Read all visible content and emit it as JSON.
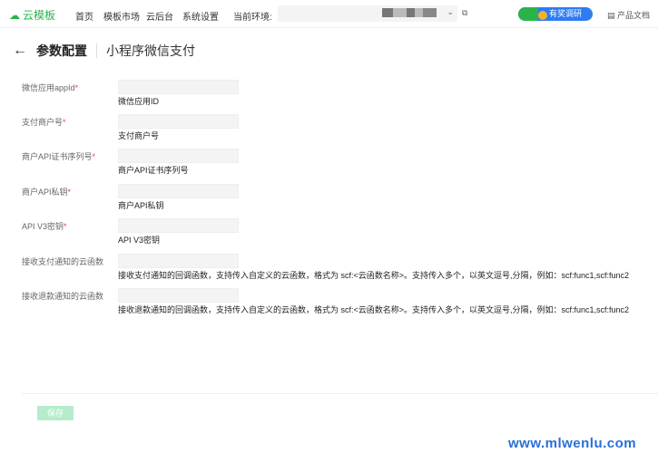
{
  "header": {
    "logo": "云模板",
    "nav": [
      "首页",
      "模板市场",
      "云后台",
      "系统设置"
    ],
    "env_label": "当前环境:",
    "survey": "有奖调研",
    "docs": "产品文档"
  },
  "page": {
    "back_icon": "arrow-left",
    "title": "参数配置",
    "subtitle": "小程序微信支付"
  },
  "fields": [
    {
      "label": "微信应用appId",
      "required": true,
      "value": "",
      "help": "微信应用ID"
    },
    {
      "label": "支付商户号",
      "required": true,
      "value": "",
      "help": "支付商户号"
    },
    {
      "label": "商户API证书序列号",
      "required": true,
      "value": "",
      "help": "商户API证书序列号"
    },
    {
      "label": "商户API私钥",
      "required": true,
      "value": "",
      "help": "商户API私钥"
    },
    {
      "label": "API V3密钥",
      "required": true,
      "value": "",
      "help": "API V3密钥"
    },
    {
      "label": "接收支付通知的云函数",
      "required": false,
      "value": "",
      "help": "接收支付通知的回调函数，支持传入自定义的云函数，格式为 scf:<云函数名称>。支持传入多个，以英文逗号,分隔，例如：scf:func1,scf:func2"
    },
    {
      "label": "接收退款通知的云函数",
      "required": false,
      "value": "",
      "help": "接收退款通知的回调函数，支持传入自定义的云函数，格式为 scf:<云函数名称>。支持传入多个，以英文逗号,分隔，例如：scf:func1,scf:func2"
    }
  ],
  "save_label": "保存",
  "watermark": "www.mlwenlu.com",
  "colors": {
    "brand": "#2bb34b",
    "required": "#e54545",
    "survey": "#2d7cf4",
    "save_disabled": "#b5eccb"
  }
}
